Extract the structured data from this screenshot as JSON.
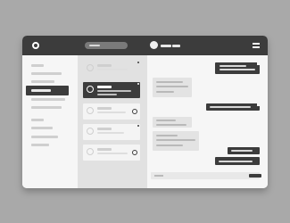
{
  "app": {
    "window_style": "wireframe mockup",
    "colors": {
      "dark": "#3c3c3c",
      "light": "#f4f4f4",
      "background": "#a9a9a9"
    }
  },
  "topbar": {
    "logo_icon": "circle-logo-icon",
    "search_placeholder": "",
    "user_name": "",
    "menu_icon": "hamburger-icon"
  },
  "sidebar": {
    "items": [
      {
        "label": "",
        "active": false
      },
      {
        "label": "",
        "active": false
      },
      {
        "label": "",
        "active": false
      },
      {
        "label": "",
        "active": true
      },
      {
        "label": "",
        "active": false
      },
      {
        "label": "",
        "active": false
      },
      {
        "label": "",
        "active": false
      },
      {
        "label": "",
        "active": false
      },
      {
        "label": "",
        "active": false
      },
      {
        "label": "",
        "active": false
      }
    ],
    "help_icon": "help-icon"
  },
  "conversations": [
    {
      "name": "",
      "preview": "",
      "active": false,
      "unread": true
    },
    {
      "name": "",
      "preview": "",
      "active": true,
      "unread": true
    },
    {
      "name": "",
      "preview": "",
      "active": false,
      "unread": true
    },
    {
      "name": "",
      "preview": "",
      "active": false,
      "unread": true
    },
    {
      "name": "",
      "preview": "",
      "active": false,
      "unread": true
    }
  ],
  "messages": [
    {
      "direction": "out",
      "text": ""
    },
    {
      "direction": "in",
      "text": ""
    },
    {
      "direction": "in",
      "text": ""
    },
    {
      "direction": "out",
      "text": ""
    },
    {
      "direction": "in",
      "text": ""
    },
    {
      "direction": "in",
      "text": ""
    },
    {
      "direction": "out",
      "text": ""
    },
    {
      "direction": "out",
      "text": ""
    }
  ],
  "composer": {
    "placeholder": "",
    "send_icon": "send-icon"
  }
}
